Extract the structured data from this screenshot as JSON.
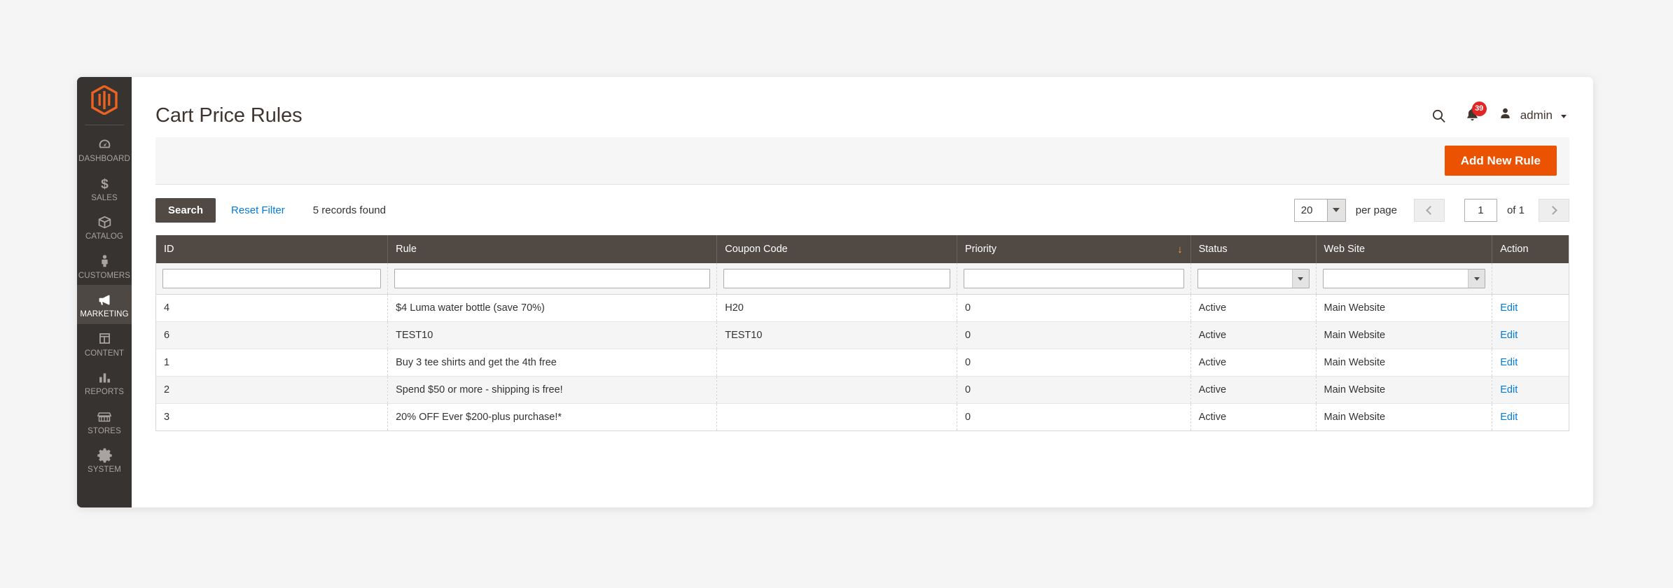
{
  "sidebar": {
    "logo_name": "magento-logo",
    "items": [
      {
        "label": "DASHBOARD",
        "icon": "dashboard-gauge-icon",
        "active": false
      },
      {
        "label": "SALES",
        "icon": "dollar-sign-icon",
        "active": false
      },
      {
        "label": "CATALOG",
        "icon": "box-icon",
        "active": false
      },
      {
        "label": "CUSTOMERS",
        "icon": "person-icon",
        "active": false
      },
      {
        "label": "MARKETING",
        "icon": "megaphone-icon",
        "active": true
      },
      {
        "label": "CONTENT",
        "icon": "layout-window-icon",
        "active": false
      },
      {
        "label": "REPORTS",
        "icon": "bar-chart-icon",
        "active": false
      },
      {
        "label": "STORES",
        "icon": "storefront-icon",
        "active": false
      },
      {
        "label": "SYSTEM",
        "icon": "gear-icon",
        "active": false
      }
    ]
  },
  "header": {
    "title": "Cart Price Rules",
    "search_icon": "search-icon",
    "notifications": {
      "icon": "bell-icon",
      "count": "39"
    },
    "user": {
      "avatar_icon": "user-avatar-icon",
      "name": "admin",
      "caret": "chevron-down-icon"
    }
  },
  "page_actions": {
    "add_new_rule_label": "Add New Rule",
    "accent_color": "#eb5202"
  },
  "toolbar": {
    "search_label": "Search",
    "reset_filter_label": "Reset Filter",
    "records_found": "5 records found",
    "per_page_value": "20",
    "per_page_label": "per page",
    "prev_icon": "chevron-left-icon",
    "next_icon": "chevron-right-icon",
    "page_value": "1",
    "of_total": "of 1"
  },
  "grid": {
    "columns": [
      {
        "key": "id",
        "label": "ID",
        "sorted": false,
        "filter": "text"
      },
      {
        "key": "rule",
        "label": "Rule",
        "sorted": false,
        "filter": "text"
      },
      {
        "key": "coupon",
        "label": "Coupon Code",
        "sorted": false,
        "filter": "text"
      },
      {
        "key": "priority",
        "label": "Priority",
        "sorted": true,
        "sort_dir": "↓",
        "filter": "text"
      },
      {
        "key": "status",
        "label": "Status",
        "sorted": false,
        "filter": "select"
      },
      {
        "key": "website",
        "label": "Web Site",
        "sorted": false,
        "filter": "select"
      },
      {
        "key": "action",
        "label": "Action",
        "sorted": false,
        "filter": "none"
      }
    ],
    "filters": {
      "id": "",
      "rule": "",
      "coupon": "",
      "priority": "",
      "status": "",
      "website": ""
    },
    "rows": [
      {
        "id": "4",
        "rule": "$4 Luma water bottle (save 70%)",
        "coupon": "H20",
        "priority": "0",
        "status": "Active",
        "website": "Main Website",
        "action": "Edit"
      },
      {
        "id": "6",
        "rule": "TEST10",
        "coupon": "TEST10",
        "priority": "0",
        "status": "Active",
        "website": "Main Website",
        "action": "Edit"
      },
      {
        "id": "1",
        "rule": "Buy 3 tee shirts and get the 4th free",
        "coupon": "",
        "priority": "0",
        "status": "Active",
        "website": "Main Website",
        "action": "Edit"
      },
      {
        "id": "2",
        "rule": "Spend $50 or more - shipping is free!",
        "coupon": "",
        "priority": "0",
        "status": "Active",
        "website": "Main Website",
        "action": "Edit"
      },
      {
        "id": "3",
        "rule": "20% OFF Ever $200-plus purchase!*",
        "coupon": "",
        "priority": "0",
        "status": "Active",
        "website": "Main Website",
        "action": "Edit"
      }
    ]
  }
}
